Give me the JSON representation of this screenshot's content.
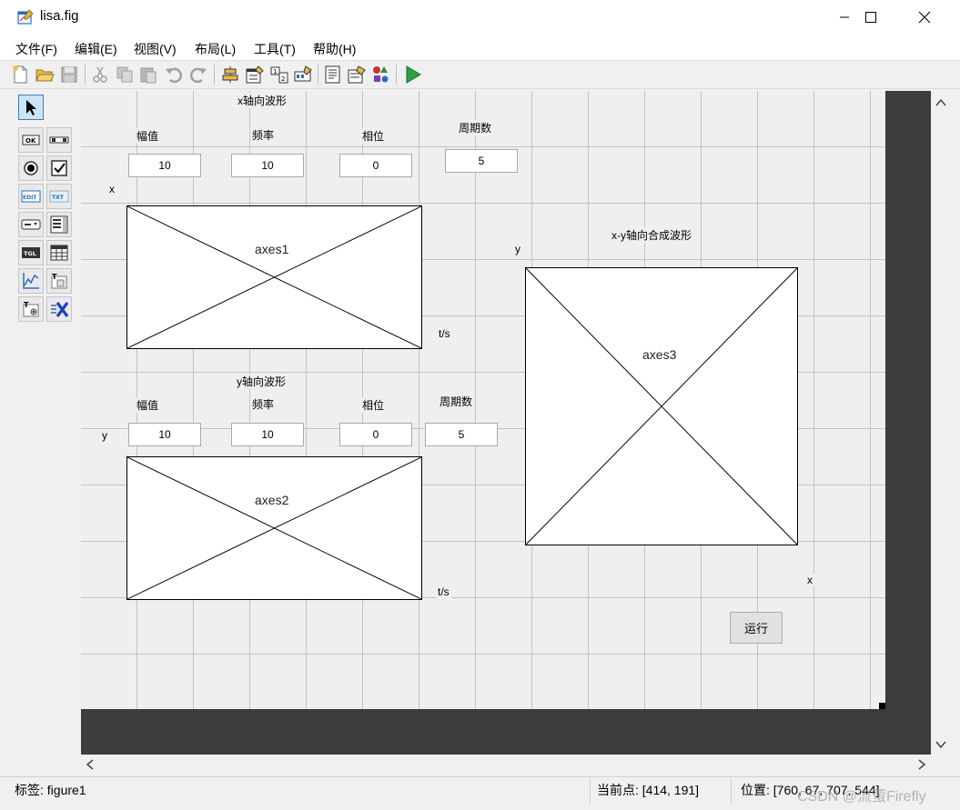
{
  "window": {
    "title": "lisa.fig",
    "controls": {
      "minimize_icon": "minimize-icon",
      "maximize_icon": "maximize-icon",
      "close_icon": "close-icon"
    }
  },
  "menu": {
    "items": [
      "文件(F)",
      "编辑(E)",
      "视图(V)",
      "布局(L)",
      "工具(T)",
      "帮助(H)"
    ]
  },
  "toolbar": {
    "icons": [
      "new-file-icon",
      "open-folder-icon",
      "save-icon",
      "cut-icon",
      "copy-icon",
      "paste-icon",
      "undo-icon",
      "redo-icon",
      "align-icon",
      "menu-editor-icon",
      "tab-order-icon",
      "toolbar-editor-icon",
      "editor-icon",
      "property-inspector-icon",
      "object-browser-icon",
      "run-icon"
    ]
  },
  "palette": {
    "tools": [
      "select-tool",
      "pushbutton-tool",
      "slider-tool",
      "radiobutton-tool",
      "checkbox-tool",
      "edit-text-tool",
      "static-text-tool",
      "popup-menu-tool",
      "listbox-tool",
      "toggle-button-tool",
      "table-tool",
      "axes-tool",
      "panel-tool",
      "button-group-tool",
      "activex-tool"
    ],
    "labels": {
      "ok": "OK",
      "edit": "EDIT",
      "txt": "TXT",
      "tgl": "TGL",
      "t": "T"
    }
  },
  "figure": {
    "x_section": {
      "title": "x轴向波形",
      "amp_label": "幅值",
      "freq_label": "频率",
      "phase_label": "相位",
      "periods_label": "周期数",
      "amp_value": "10",
      "freq_value": "10",
      "phase_value": "0",
      "periods_value": "5",
      "ylabel": "x",
      "xlabel": "t/s",
      "axes_tag": "axes1"
    },
    "y_section": {
      "title": "y轴向波形",
      "amp_label": "幅值",
      "freq_label": "频率",
      "phase_label": "相位",
      "periods_label": "周期数",
      "amp_value": "10",
      "freq_value": "10",
      "phase_value": "0",
      "periods_value": "5",
      "ylabel": "y",
      "xlabel": "t/s",
      "axes_tag": "axes2"
    },
    "xy_section": {
      "title": "x-y轴向合成波形",
      "ylabel": "y",
      "xlabel": "x",
      "axes_tag": "axes3"
    },
    "run_button": "运行"
  },
  "status": {
    "tag": "标签: figure1",
    "current_point": "当前点:  [414, 191]",
    "position": "位置: [760, 67, 707, 544]"
  },
  "watermark": "CSDN @流萤Firefly"
}
